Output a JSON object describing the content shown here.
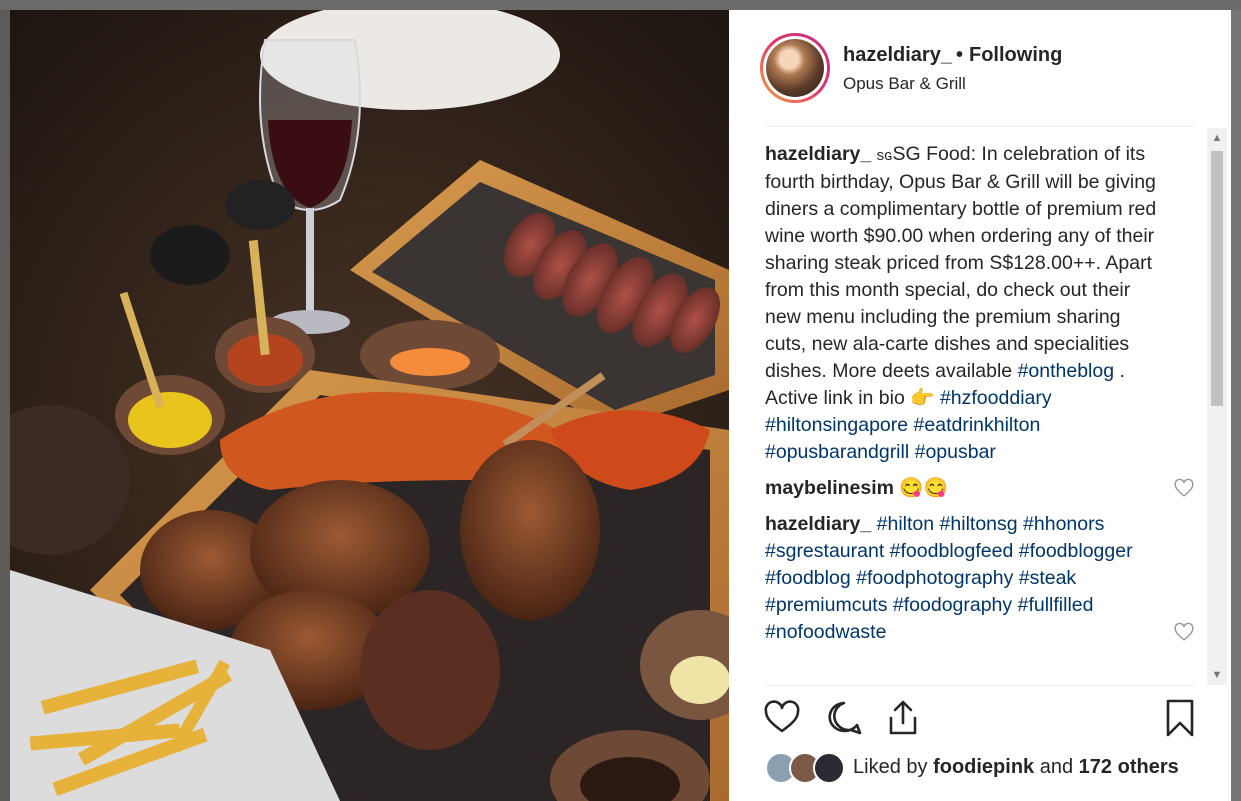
{
  "post": {
    "username": "hazeldiary_",
    "separator": "•",
    "follow_status": "Following",
    "location": "Opus Bar & Grill"
  },
  "caption": {
    "author": "hazeldiary_",
    "text": "SG Food: In celebration of its fourth birthday, Opus Bar & Grill will be giving diners a complimentary bottle of premium red wine worth $90.00 when ordering any of their sharing steak priced from S$128.00++. Apart from this month special, do check out their new menu including the premium sharing cuts, new ala-carte dishes and specialities dishes. More deets available",
    "sg_emoji": "sɢ",
    "tag1": "#ontheblog",
    "after_tag1": " .",
    "line2_prefix": "Active link in bio",
    "pointing_emoji": "👉",
    "tags_line": [
      "#hzfooddiary",
      "#hiltonsingapore",
      "#eatdrinkhilton",
      "#opusbarandgrill",
      "#opusbar"
    ]
  },
  "comments": [
    {
      "author": "maybelinesim",
      "text": "😋😋"
    },
    {
      "author": "hazeldiary_",
      "tags": [
        "#hilton",
        "#hiltonsg",
        "#hhonors",
        "#sgrestaurant",
        "#foodblogfeed",
        "#foodblogger",
        "#foodblog",
        "#foodphotography",
        "#steak",
        "#premiumcuts",
        "#foodography",
        "#fullfilled",
        "#nofoodwaste"
      ]
    }
  ],
  "likes": {
    "prefix": "Liked by",
    "user": "foodiepink",
    "middle": "and",
    "others": "172 others"
  },
  "icons": [
    "heart-icon",
    "comment-icon",
    "share-icon",
    "bookmark-icon",
    "scroll-up-arrow",
    "scroll-down-arrow"
  ],
  "colors": {
    "hashtag": "#003569",
    "text": "#262626",
    "ring_start": "#f9a03f",
    "ring_end": "#c13584"
  }
}
